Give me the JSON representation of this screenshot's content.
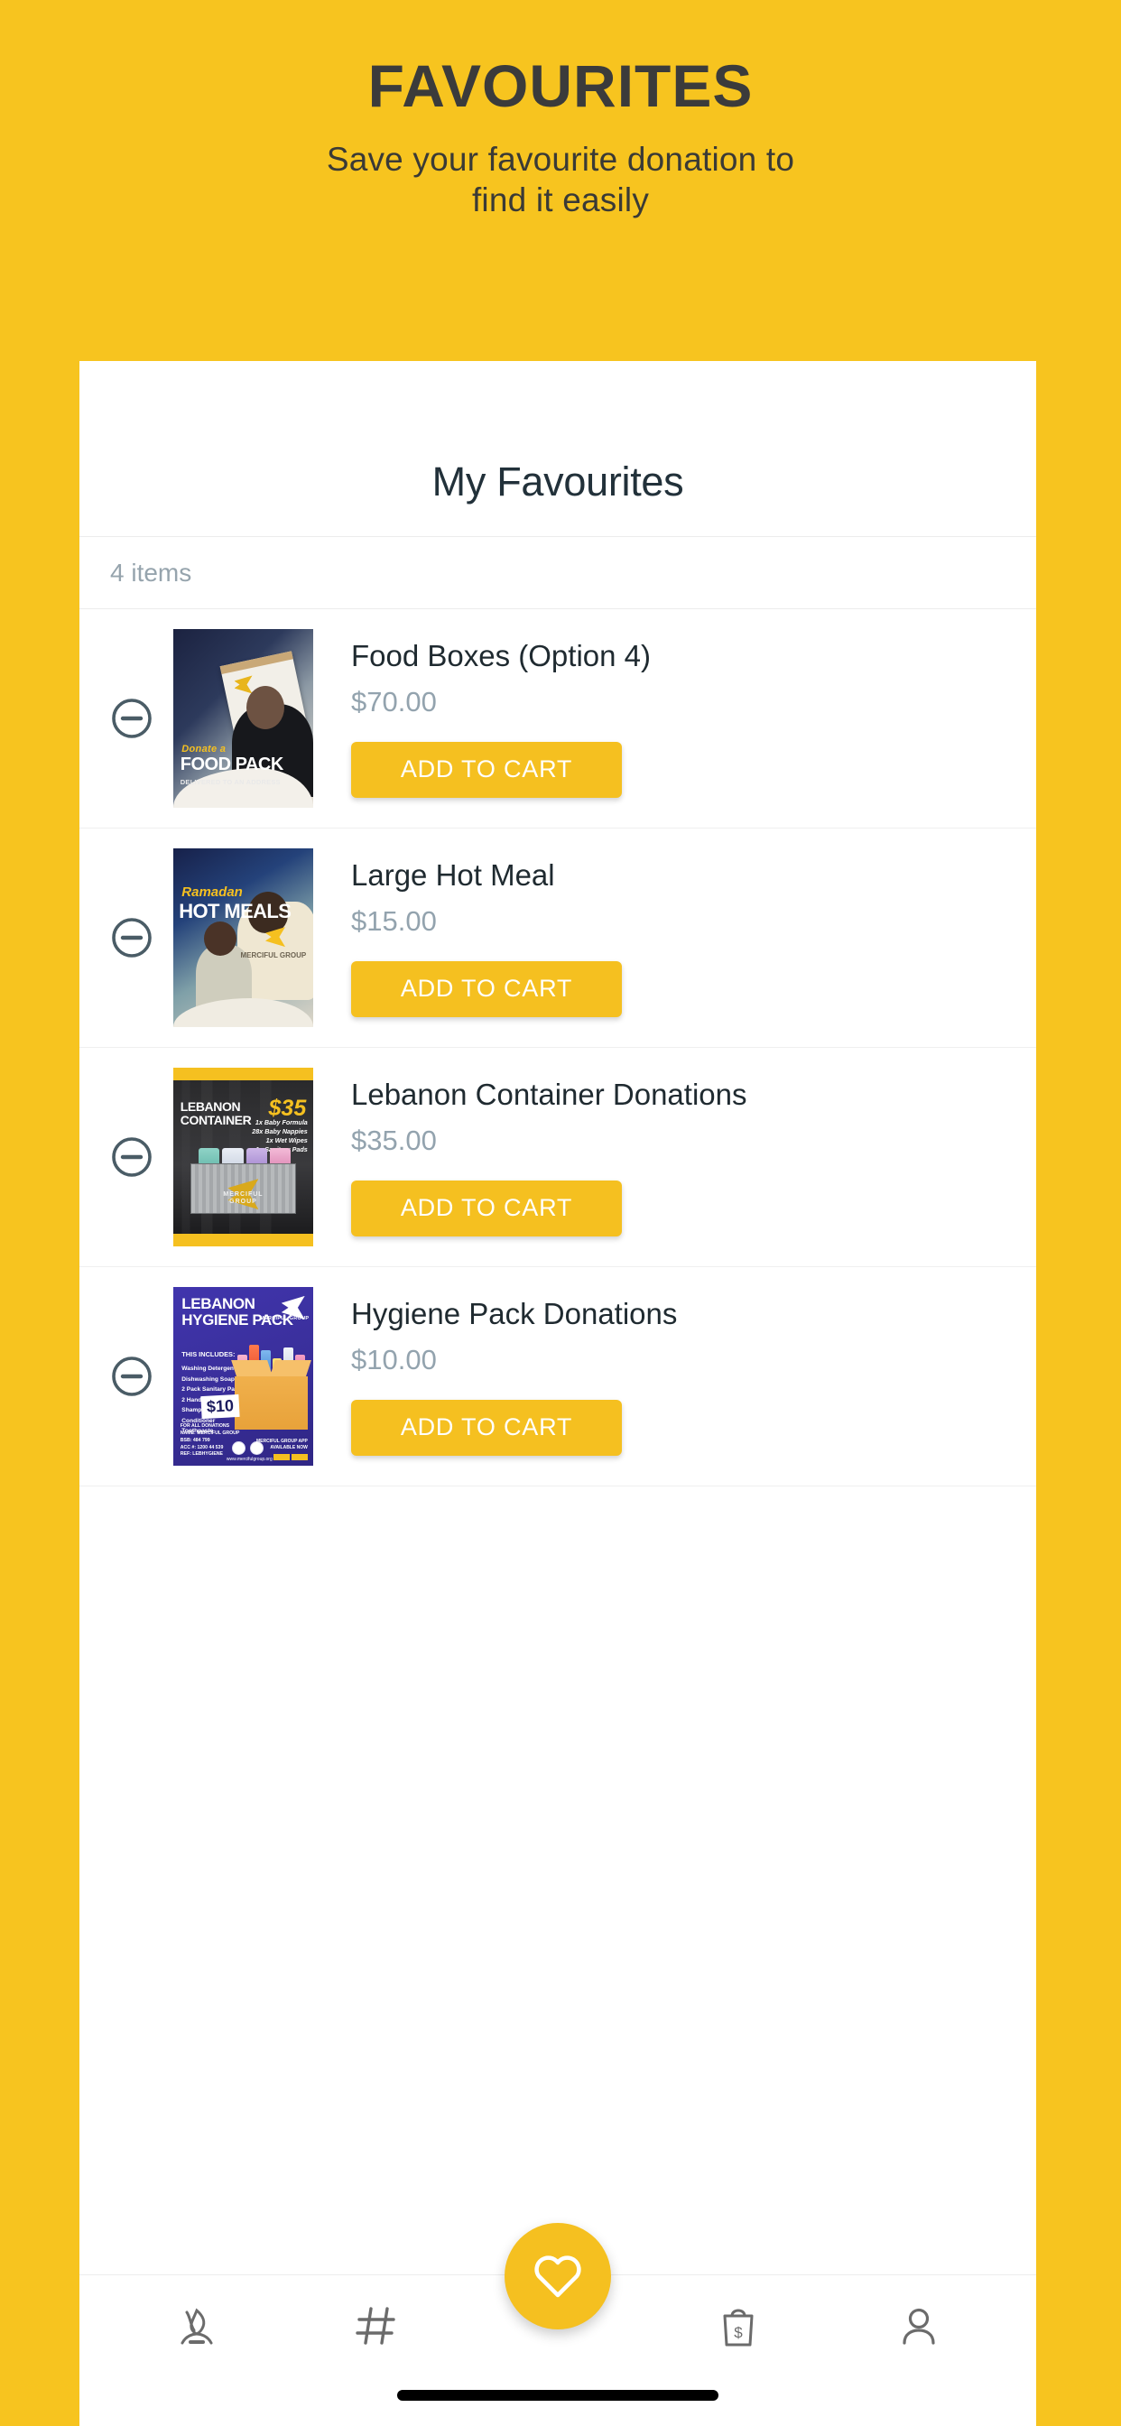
{
  "hero": {
    "title": "FAVOURITES",
    "subtitle": "Save your favourite donation to\nfind it easily"
  },
  "card": {
    "heading": "My Favourites",
    "item_count_label": "4 items"
  },
  "items": [
    {
      "title": "Food Boxes (Option 4)",
      "price": "$70.00",
      "add_to_cart_label": "ADD TO CART",
      "remove_label": "Remove",
      "image": {
        "line1": "Donate a",
        "line2": "FOOD PACK",
        "line3": "DELIVERED TO AN ADDRESS"
      }
    },
    {
      "title": "Large Hot Meal",
      "price": "$15.00",
      "add_to_cart_label": "ADD TO CART",
      "remove_label": "Remove",
      "image": {
        "line1": "Ramadan",
        "line2": "HOT MEALS",
        "line3": "MERCIFUL GROUP"
      }
    },
    {
      "title": "Lebanon Container Donations",
      "price": "$35.00",
      "add_to_cart_label": "ADD TO CART",
      "remove_label": "Remove",
      "image": {
        "line1": "LEBANON CONTAINER",
        "price_badge": "$35",
        "list": "1x Baby Formula\n28x Baby Nappies\n1x Wet Wipes\n1x Sanitary Pads",
        "brand": "MERCIFUL GROUP"
      }
    },
    {
      "title": "Hygiene Pack Donations",
      "price": "$10.00",
      "add_to_cart_label": "ADD TO CART",
      "remove_label": "Remove",
      "image": {
        "line1": "LEBANON HYGIENE PACK",
        "includes_heading": "THIS INCLUDES:",
        "includes": "Washing Detergent\nDishwashing Soap\n2 Pack Sanitary Pads\n2 Handwash Soap\nShampoo\nConditioner\nToothpaste",
        "price_badge": "$10",
        "footer": "FOR ALL DONATIONS\nNAME: MERCIFUL GROUP\nBSB: 484 799\nACC #: 1200 44 539\nREF: LEBHYGIENE",
        "url": "www.mercifulgroup.org",
        "app_note": "MERCIFUL GROUP APP\nAVAILABLE NOW",
        "brand": "MERCIFUL GROUP"
      }
    }
  ],
  "bottom_nav": {
    "items": [
      {
        "icon": "donate-flame-icon",
        "label": ""
      },
      {
        "icon": "hashtag-icon",
        "label": ""
      },
      {
        "icon": "shopping-bag-dollar-icon",
        "label": ""
      },
      {
        "icon": "person-icon",
        "label": ""
      }
    ],
    "fab": {
      "icon": "heart-icon",
      "label": ""
    }
  },
  "colors": {
    "brand_yellow": "#F7C41F",
    "button_yellow": "#F5C020",
    "title_dark": "#3b3b3b",
    "price_gray": "#93a3ae",
    "card_white": "#FFFFFF"
  }
}
